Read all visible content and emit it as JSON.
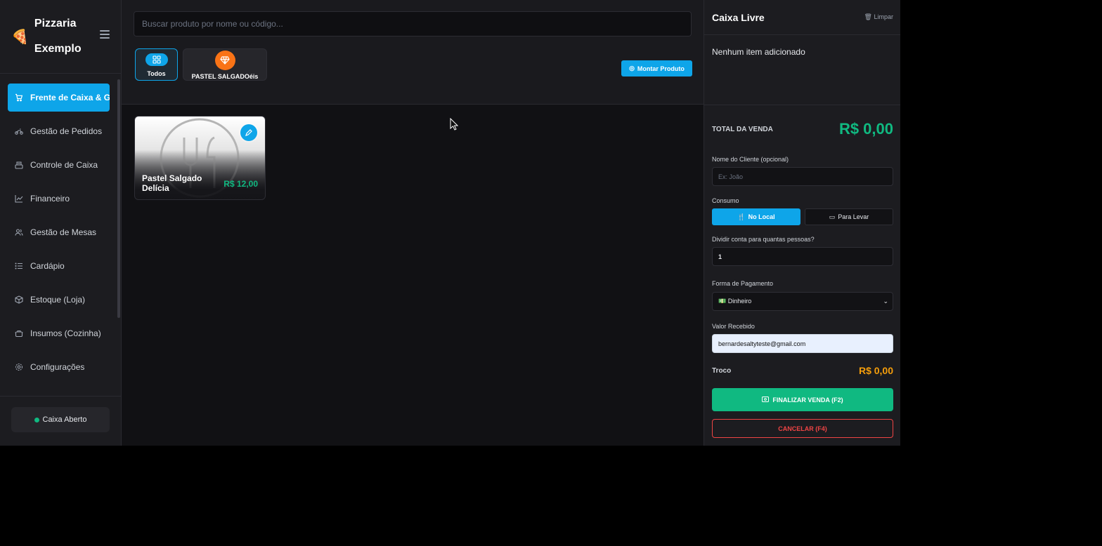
{
  "brand": {
    "logo_icon": "pizza-icon",
    "name": "Pizzaria Exemplo"
  },
  "sidebar": {
    "items": [
      {
        "label": "Frente de Caixa & Gestor",
        "icon": "cart-icon",
        "active": true
      },
      {
        "label": "Gestão de Pedidos",
        "icon": "motorcycle-icon"
      },
      {
        "label": "Controle de Caixa",
        "icon": "cash-register-icon"
      },
      {
        "label": "Financeiro",
        "icon": "chart-line-icon"
      },
      {
        "label": "Gestão de Mesas",
        "icon": "users-icon"
      },
      {
        "label": "Cardápio",
        "icon": "list-icon"
      },
      {
        "label": "Estoque (Loja)",
        "icon": "box-icon"
      },
      {
        "label": "Insumos (Cozinha)",
        "icon": "pot-icon"
      },
      {
        "label": "Configurações",
        "icon": "gear-icon"
      }
    ],
    "status": {
      "label": "Caixa Aberto",
      "color": "#10b981"
    }
  },
  "main": {
    "search_placeholder": "Buscar produto por nome ou código...",
    "categories": [
      {
        "label": "Todos",
        "icon": "grid-icon",
        "selected": true
      },
      {
        "label": "PASTEL SALGADOéis",
        "icon": "gem-icon"
      }
    ],
    "montar_label": "Montar Produto",
    "products": [
      {
        "name": "Pastel Salgado Delícia",
        "price": "R$ 12,00"
      }
    ]
  },
  "cart": {
    "title": "Caixa Livre",
    "clear_label": "Limpar",
    "empty_text": "Nenhum item adicionado",
    "total_label": "TOTAL DA VENDA",
    "total_value": "R$ 0,00",
    "client_label": "Nome do Cliente (opcional)",
    "client_placeholder": "Ex: João",
    "consumo_label": "Consumo",
    "consumo_local": "No Local",
    "consumo_levar": "Para Levar",
    "split_label": "Dividir conta para quantas pessoas?",
    "split_value": "1",
    "payment_label": "Forma de Pagamento",
    "payment_value": "💵 Dinheiro",
    "received_label": "Valor Recebido",
    "received_value": "bernardesaltyteste@gmail.com",
    "troco_label": "Troco",
    "troco_value": "R$ 0,00",
    "finalize_label": "FINALIZAR VENDA (F2)",
    "cancel_label": "CANCELAR (F4)"
  },
  "colors": {
    "accent": "#0ea5e9",
    "success": "#10b981",
    "warning": "#f59e0b",
    "danger": "#ef4444",
    "category_badge": "#f97316"
  }
}
